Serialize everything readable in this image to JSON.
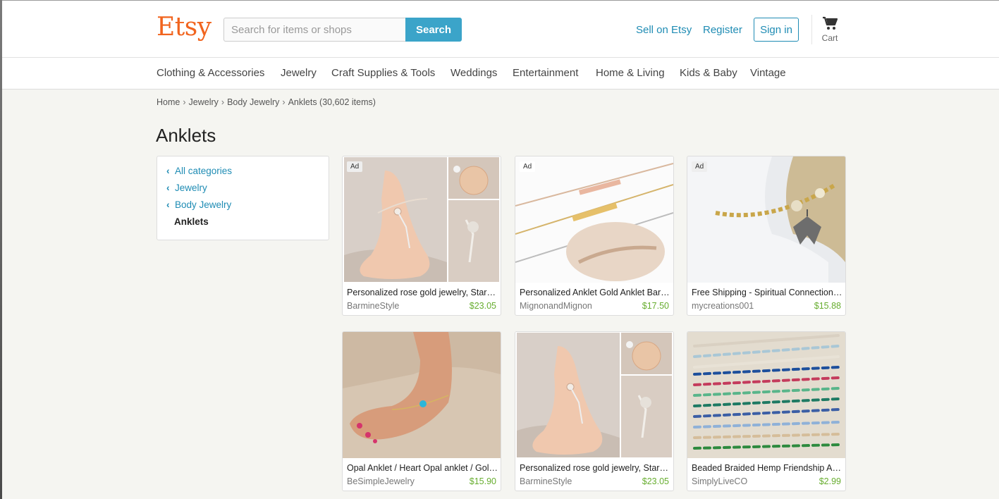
{
  "header": {
    "logo": "Etsy",
    "search": {
      "placeholder": "Search for items or shops",
      "button_label": "Search"
    },
    "sell_label": "Sell on Etsy",
    "register_label": "Register",
    "signin_label": "Sign in",
    "cart_label": "Cart"
  },
  "categories": [
    "Clothing & Accessories",
    "Jewelry",
    "Craft Supplies & Tools",
    "Weddings",
    "Entertainment",
    "Home & Living",
    "Kids & Baby",
    "Vintage"
  ],
  "breadcrumb": {
    "home": "Home",
    "jewelry": "Jewelry",
    "body_jewelry": "Body Jewelry",
    "current": "Anklets (30,602 items)"
  },
  "page_title": "Anklets",
  "sidebar": {
    "all_categories": "All categories",
    "jewelry": "Jewelry",
    "body_jewelry": "Body Jewelry",
    "current": "Anklets"
  },
  "listings": [
    {
      "ad": "Ad",
      "title": "Personalized rose gold jewelry, Starfish barefoot sandals",
      "shop": "BarmineStyle",
      "price": "$23.05"
    },
    {
      "ad": "Ad",
      "title": "Personalized Anklet Gold Anklet Bar Anklet",
      "shop": "MignonandMignon",
      "price": "$17.50"
    },
    {
      "ad": "Ad",
      "title": "Free Shipping - Spiritual Connection Butterfly Anklet",
      "shop": "mycreations001",
      "price": "$15.88"
    },
    {
      "ad": "",
      "title": "Opal Anklet / Heart Opal anklet / Gold anklet",
      "shop": "BeSimpleJewelry",
      "price": "$15.90"
    },
    {
      "ad": "",
      "title": "Personalized rose gold jewelry, Starfish barefoot sandals",
      "shop": "BarmineStyle",
      "price": "$23.05"
    },
    {
      "ad": "",
      "title": "Beaded Braided Hemp Friendship Anklet",
      "shop": "SimplyLiveCO",
      "price": "$2.99"
    }
  ],
  "colors": {
    "brand": "#f1641e",
    "accent": "#3ba4c9",
    "link": "#1f8cb4",
    "price": "#67ad2f"
  }
}
